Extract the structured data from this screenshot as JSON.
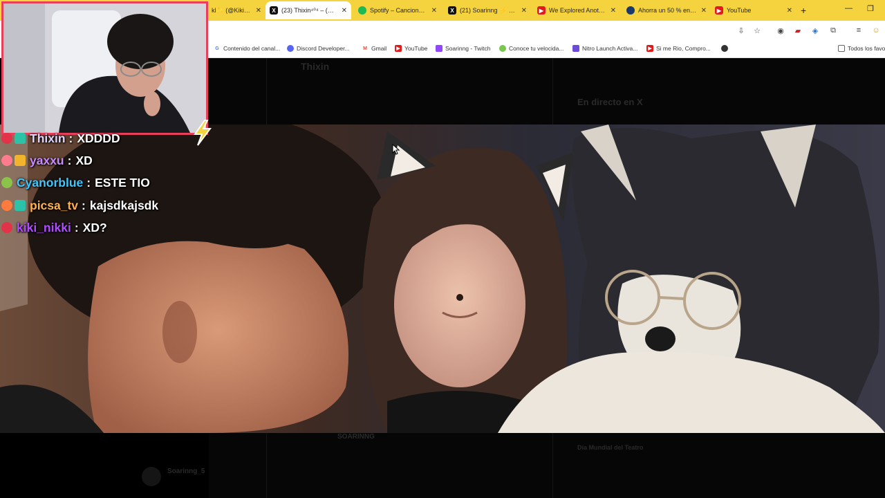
{
  "tabs": [
    {
      "label": "kl✨ (@Kiki_…",
      "favicon": "x-icon",
      "color": "#111111",
      "active": false
    },
    {
      "label": "(23) Thixin⁴⁰⁴ – (@Thi…",
      "favicon": "x-icon",
      "color": "#111111",
      "active": true
    },
    {
      "label": "Spotify – Canciones o…",
      "favicon": "spotify-icon",
      "color": "#1db954",
      "active": false
    },
    {
      "label": "(21) Soarinng ⚡ (@…",
      "favicon": "x-icon",
      "color": "#111111",
      "active": false
    },
    {
      "label": "We Explored Another…",
      "favicon": "youtube-icon",
      "color": "#e11b1b",
      "active": false
    },
    {
      "label": "Ahorra un 50 % en C…",
      "favicon": "steam-icon",
      "color": "#1b3a6b",
      "active": false
    },
    {
      "label": "YouTube",
      "favicon": "youtube-icon",
      "color": "#e11b1b",
      "active": false
    }
  ],
  "bookmarks": [
    {
      "label": "Contenido del canal...",
      "icon": "google-icon",
      "color": "#4285f4"
    },
    {
      "label": "Discord Developer...",
      "icon": "discord-icon",
      "color": "#5865f2"
    },
    {
      "label": "Gmail",
      "icon": "gmail-icon",
      "color": "#ea4335"
    },
    {
      "label": "YouTube",
      "icon": "youtube-icon",
      "color": "#e11b1b"
    },
    {
      "label": "Soarinng - Twitch",
      "icon": "twitch-icon",
      "color": "#9146ff"
    },
    {
      "label": "Conoce tu velocida...",
      "icon": "speedtest-icon",
      "color": "#7ac74f"
    },
    {
      "label": "Nitro Launch Activa...",
      "icon": "nitro-icon",
      "color": "#6c4bd8"
    },
    {
      "label": "Si me Rio, Compro...",
      "icon": "youtube-icon",
      "color": "#e11b1b"
    },
    {
      "label": "",
      "icon": "globe-icon",
      "color": "#333333"
    }
  ],
  "all_bookmarks": "Todos los favo",
  "x_page": {
    "profile_name": "Thixin",
    "section_live": "En directo en X",
    "footer_user": "Soarinng_5",
    "teatro": "Día Mundial del Teatro",
    "soarinng_banner": "SOARINNG"
  },
  "chat": [
    {
      "user": "Thixin",
      "message": "XDDDD",
      "color": "#e0d4ff"
    },
    {
      "user": "yaxxu",
      "message": "XD",
      "color": "#c98cff"
    },
    {
      "user": "Cyanorblue",
      "message": "ESTE TIO",
      "color": "#3cc8ff"
    },
    {
      "user": "picsa_tv",
      "message": "kajsdkajsdk",
      "color": "#ffb24d"
    },
    {
      "user": "kiki_nikki",
      "message": "XD?",
      "color": "#b04cff"
    }
  ],
  "colors": {
    "tabbar": "#f5d33f",
    "cam_border": "#e8405a"
  }
}
